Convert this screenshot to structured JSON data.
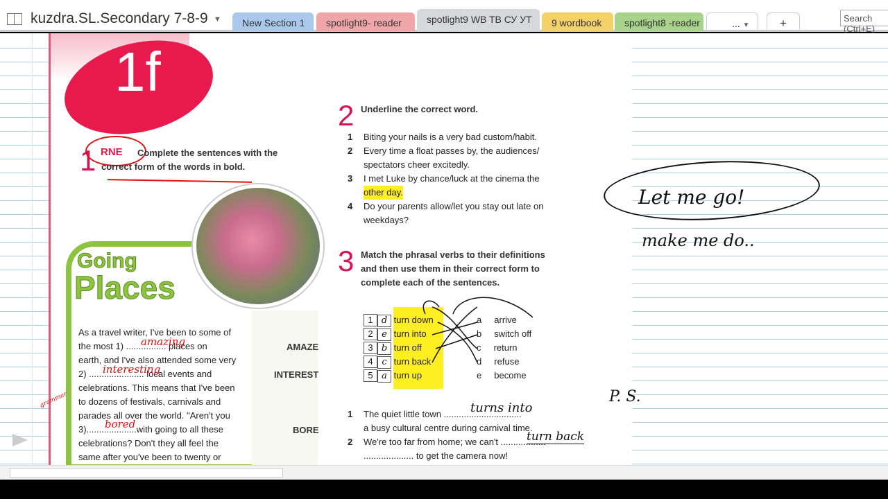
{
  "notebook": {
    "title": "kuzdra.SL.Secondary 7-8-9"
  },
  "tabs": [
    {
      "label": "New Section 1",
      "color": "#a9c8eb"
    },
    {
      "label": "spotlight9- reader",
      "color": "#f0a6a8"
    },
    {
      "label": "spotlight9 WB TB СУ УТ",
      "color": "#d6d8dc"
    },
    {
      "label": "9 wordbook",
      "color": "#f5d16a"
    },
    {
      "label": "spotlight8 -reader",
      "color": "#a8d38a"
    },
    {
      "label": "...",
      "color": "#ffffff"
    },
    {
      "label": "+",
      "color": "#ffffff"
    }
  ],
  "search": {
    "placeholder": "Search (Ctrl+E)"
  },
  "book": {
    "unit": "1f",
    "ex1": {
      "num": "1",
      "badge": "RNE",
      "instruction": "Complete the sentences with the correct form of the words in bold."
    },
    "heading1": "Going",
    "heading2": "Places",
    "passage": [
      "As a travel writer, I've been to some of",
      "the most 1) ................ places on",
      "earth, and I've also attended some very",
      "2) ...................... local events and",
      "celebrations. This means that I've been",
      "to dozens of festivals, carnivals and",
      "parades all over the world. \"Aren't you",
      "3)....................with going to all these",
      "celebrations? Don't they all feel the",
      "same after you've been to twenty or"
    ],
    "bold_words": [
      "AMAZE",
      "INTEREST",
      "BORE"
    ],
    "ex2": {
      "num": "2",
      "instruction": "Underline the correct word.",
      "items": [
        {
          "n": "1",
          "lines": [
            "Biting your nails is a very bad custom/habit."
          ]
        },
        {
          "n": "2",
          "lines": [
            "Every time a float passes by, the audiences/",
            "spectators cheer excitedly."
          ]
        },
        {
          "n": "3",
          "lines": [
            "I met Luke by chance/luck at the cinema the",
            "other day."
          ]
        },
        {
          "n": "4",
          "lines": [
            "Do your parents allow/let you stay out late on",
            "weekdays?"
          ]
        }
      ]
    },
    "ex3": {
      "num": "3",
      "instruction": [
        "Match the phrasal verbs to their definitions",
        "and then use them in their correct form to",
        "complete each of the sentences."
      ],
      "verbs": [
        {
          "n": "1",
          "ans": "d",
          "v": "turn down"
        },
        {
          "n": "2",
          "ans": "e",
          "v": "turn into"
        },
        {
          "n": "3",
          "ans": "b",
          "v": "turn off"
        },
        {
          "n": "4",
          "ans": "c",
          "v": "turn back"
        },
        {
          "n": "5",
          "ans": "a",
          "v": "turn up"
        }
      ],
      "defs": [
        {
          "l": "a",
          "d": "arrive"
        },
        {
          "l": "b",
          "d": "switch off"
        },
        {
          "l": "c",
          "d": "return"
        },
        {
          "l": "d",
          "d": "refuse"
        },
        {
          "l": "e",
          "d": "become"
        }
      ],
      "sentences": [
        {
          "n": "1",
          "lines": [
            "The quiet little town ...............................",
            "a busy cultural centre during carnival time."
          ]
        },
        {
          "n": "2",
          "lines": [
            "We're too far from home; we can't ..................",
            ".................... to get the camera now!"
          ]
        }
      ]
    }
  },
  "ink": {
    "a1": "amazing",
    "a2": "interesting",
    "a3": "bored",
    "margin": "grammar",
    "s1": "turns into",
    "s2": "turn back",
    "note1": "Let me go!",
    "note2": "make me do..",
    "note3": "P. S."
  }
}
